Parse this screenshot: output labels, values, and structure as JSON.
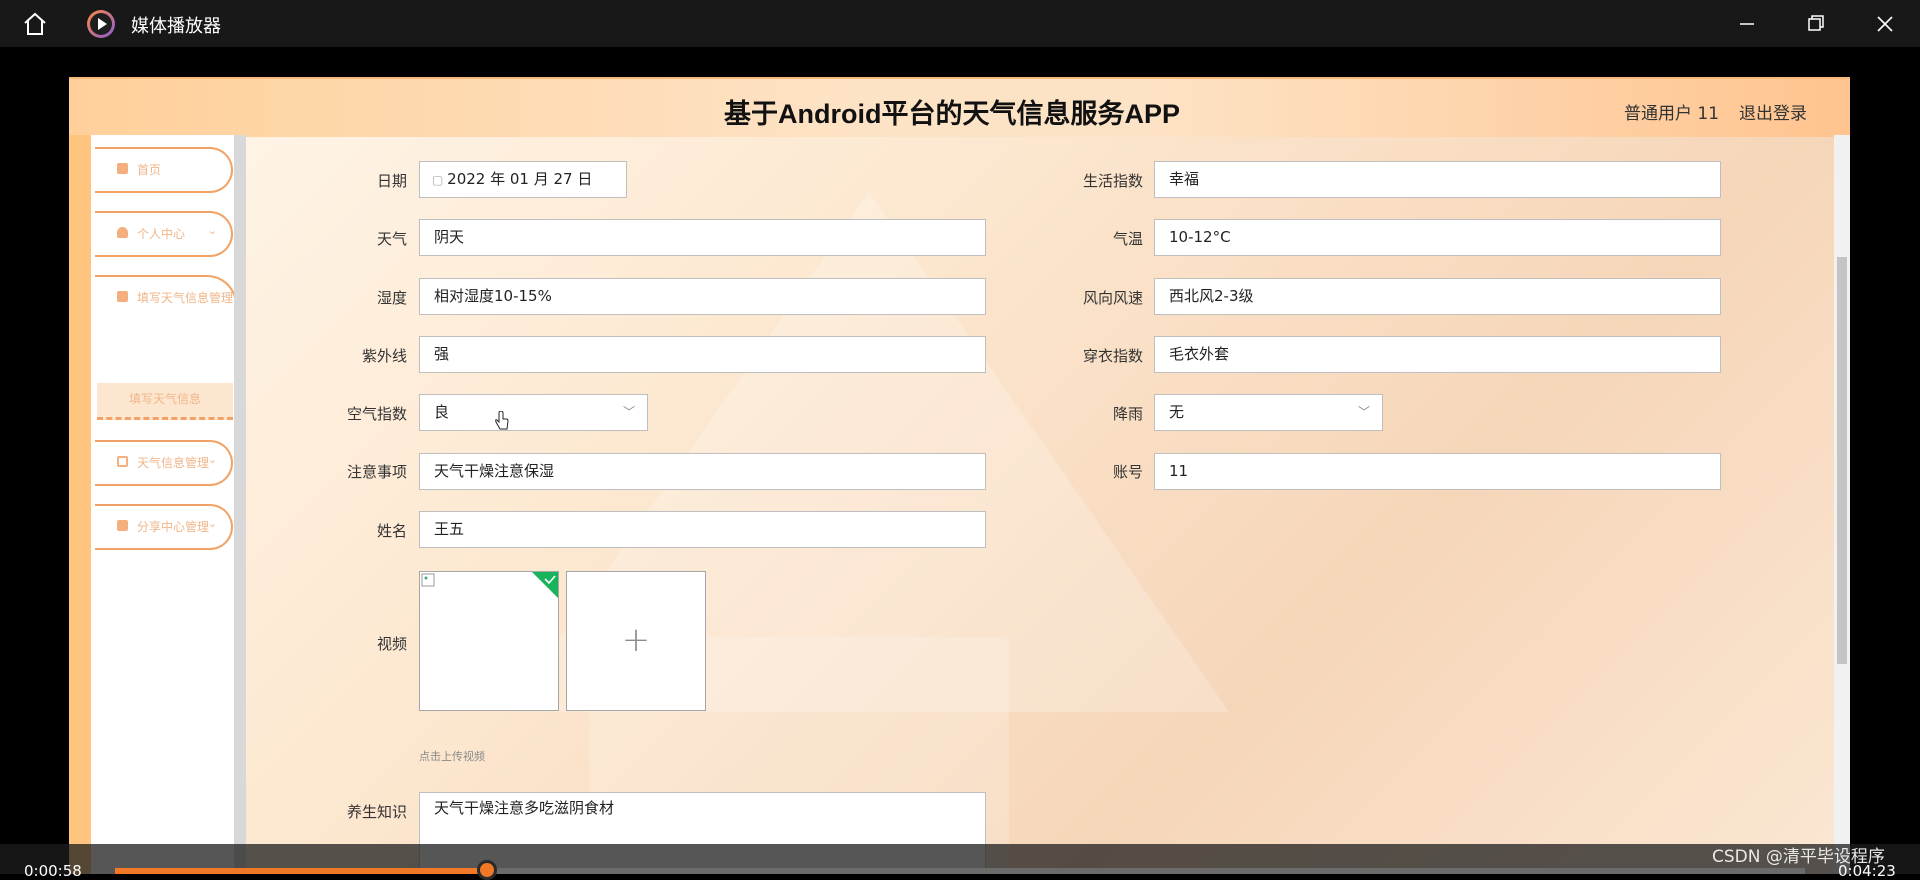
{
  "player": {
    "title": "媒体播放器",
    "current_time": "0:00:58",
    "total_time": "0:04:23",
    "progress": 0.22
  },
  "app": {
    "title": "基于Android平台的天气信息服务APP",
    "user": "普通用户 11",
    "logout": "退出登录"
  },
  "sidebar": {
    "items": [
      {
        "label": "首页",
        "icon": "home-icon"
      },
      {
        "label": "个人中心",
        "icon": "user-icon",
        "chevron": "⌄"
      },
      {
        "label": "填写天气信息管理",
        "icon": "briefcase-icon"
      },
      {
        "label": "天气信息管理",
        "icon": "grid-icon",
        "chevron": "⌄"
      },
      {
        "label": "分享中心管理",
        "icon": "clipboard-icon",
        "chevron": "⌄"
      }
    ],
    "sub_item": "填写天气信息"
  },
  "form": {
    "date": {
      "label": "日期",
      "value": "2022 年 01 月 27 日"
    },
    "life_index": {
      "label": "生活指数",
      "value": "幸福"
    },
    "weather": {
      "label": "天气",
      "value": "阴天"
    },
    "temperature": {
      "label": "气温",
      "value": "10-12°C"
    },
    "humidity": {
      "label": "湿度",
      "value": "相对湿度10-15%"
    },
    "wind": {
      "label": "风向风速",
      "value": "西北风2-3级"
    },
    "uv": {
      "label": "紫外线",
      "value": "强"
    },
    "clothing": {
      "label": "穿衣指数",
      "value": "毛衣外套"
    },
    "air": {
      "label": "空气指数",
      "value": "良"
    },
    "rain": {
      "label": "降雨",
      "value": "无"
    },
    "notes": {
      "label": "注意事项",
      "value": "天气干燥注意保湿"
    },
    "account": {
      "label": "账号",
      "value": "11"
    },
    "name": {
      "label": "姓名",
      "value": "王五"
    },
    "video": {
      "label": "视频",
      "tip": "点击上传视频",
      "add": "+"
    },
    "health": {
      "label": "养生知识",
      "value": "天气干燥注意多吃滋阴食材"
    }
  },
  "watermark": "CSDN @清平毕设程序",
  "colors": {
    "accent": "#f07826",
    "nav_border": "#f3a266",
    "check": "#19b35c"
  }
}
